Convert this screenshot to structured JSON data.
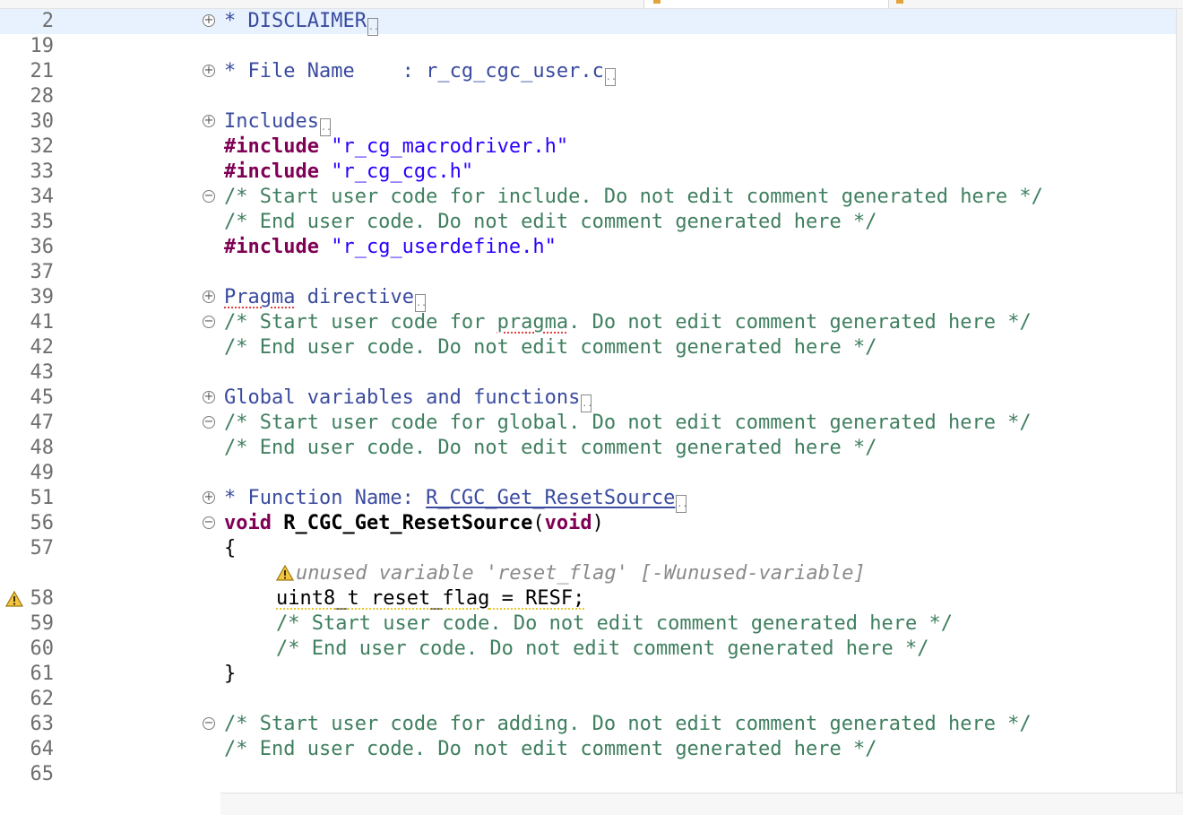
{
  "editor": {
    "lines": [
      {
        "num": "2",
        "fold": "+",
        "text": "* DISCLAIMER",
        "box": "..",
        "current": true
      },
      {
        "num": "19"
      },
      {
        "num": "21",
        "fold": "+",
        "text": "* File Name    : r_cg_cgc_user.c",
        "box": ".."
      },
      {
        "num": "28"
      },
      {
        "num": "30",
        "fold": "+",
        "text": "Includes",
        "box": ".."
      },
      {
        "num": "32",
        "kw": "#include",
        "str": " \"r_cg_macrodriver.h\""
      },
      {
        "num": "33",
        "kw": "#include",
        "str": " \"r_cg_cgc.h\""
      },
      {
        "num": "34",
        "fold": "−",
        "comment": "/* Start user code for include. Do not edit comment generated here */"
      },
      {
        "num": "35",
        "comment": "/* End user code. Do not edit comment generated here */"
      },
      {
        "num": "36",
        "kw": "#include",
        "str": " \"r_cg_userdefine.h\""
      },
      {
        "num": "37"
      },
      {
        "num": "39",
        "fold": "+",
        "text_a": "Pragma",
        "text_b": " directive",
        "box": ".."
      },
      {
        "num": "41",
        "fold": "−",
        "comment_a": "/* Start user code for ",
        "comment_b": "pragma",
        "comment_c": ". Do not edit comment generated here */"
      },
      {
        "num": "42",
        "comment": "/* End user code. Do not edit comment generated here */"
      },
      {
        "num": "43"
      },
      {
        "num": "45",
        "fold": "+",
        "text": "Global variables and functions",
        "box": ".."
      },
      {
        "num": "47",
        "fold": "−",
        "comment": "/* Start user code for global. Do not edit comment generated here */"
      },
      {
        "num": "48",
        "comment": "/* End user code. Do not edit comment generated here */"
      },
      {
        "num": "49"
      },
      {
        "num": "51",
        "fold": "+",
        "text_a": "* Function Name: ",
        "text_b": "R_CGC_Get_ResetSource",
        "box": ".."
      },
      {
        "num": "56",
        "fold": "−",
        "kw": "void",
        "fn": " R_CGC_Get_ResetSource",
        "rest_a": "(",
        "kw2": "void",
        "rest_b": ")"
      },
      {
        "num": "57",
        "plain": "{"
      },
      {
        "num": "",
        "annotation": "unused variable 'reset_flag' [-Wunused-variable]"
      },
      {
        "num": "58",
        "warning": true,
        "code_a": "uint8_t",
        "code_b": " reset_flag",
        "code_c": " = RESF;"
      },
      {
        "num": "59",
        "comment": "/* Start user code. Do not edit comment generated here */"
      },
      {
        "num": "60",
        "comment": "/* End user code. Do not edit comment generated here */"
      },
      {
        "num": "61",
        "plain": "}"
      },
      {
        "num": "62"
      },
      {
        "num": "63",
        "fold": "−",
        "comment": "/* Start user code for adding. Do not edit comment generated here */"
      },
      {
        "num": "64",
        "comment": "/* End user code. Do not edit comment generated here */"
      },
      {
        "num": "65"
      }
    ]
  },
  "colors": {
    "comment": "#3f7f5f",
    "folded_header": "#3a4b9f",
    "keyword": "#7f0055",
    "string": "#2a00ff",
    "current_line": "#e8f2fe",
    "warning": "#e8b400"
  },
  "icons": {
    "fold_expand": "plus-circle-icon",
    "fold_collapse": "minus-circle-icon",
    "warning": "warning-triangle-icon"
  }
}
